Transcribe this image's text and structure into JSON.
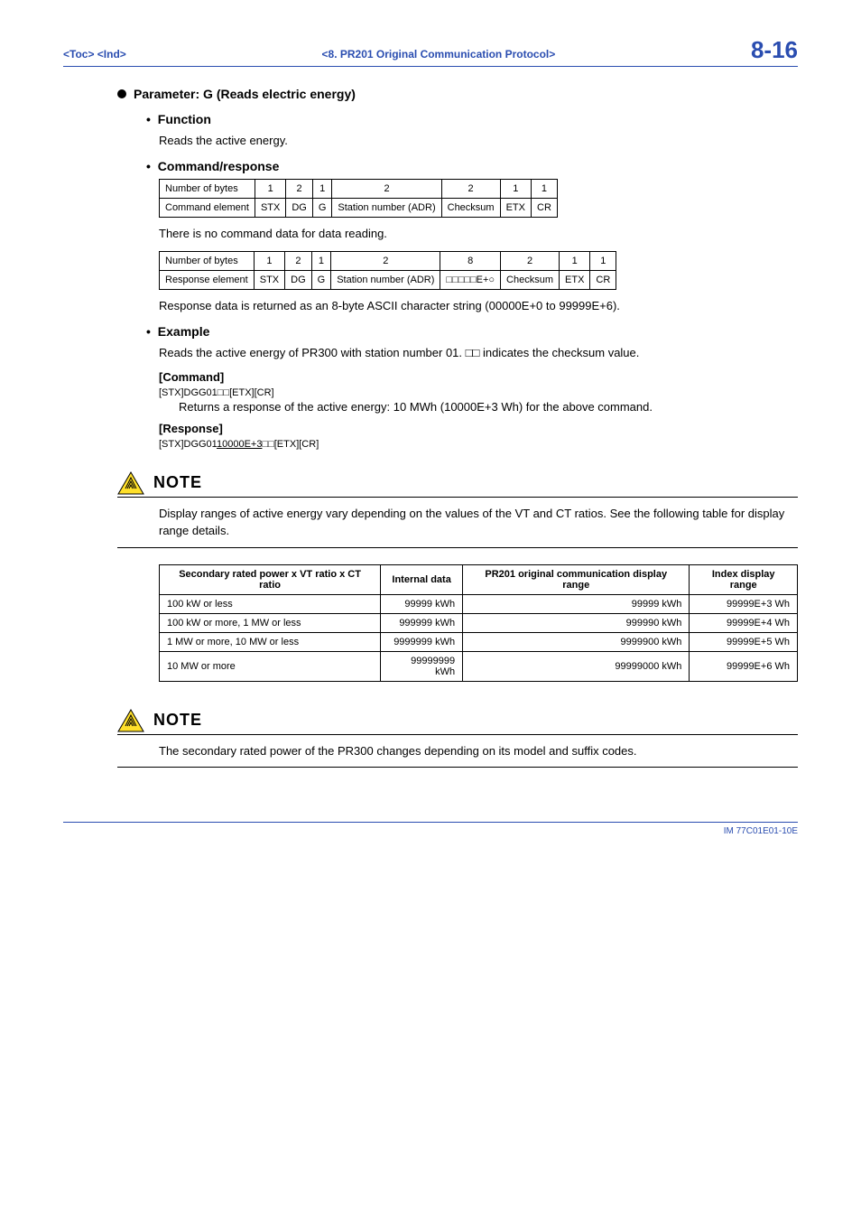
{
  "header": {
    "left": "<Toc> <Ind>",
    "center": "<8.  PR201 Original Communication Protocol>",
    "page": "8-16"
  },
  "param_heading": "Parameter: G (Reads electric energy)",
  "function": {
    "heading": "Function",
    "text": "Reads the active energy."
  },
  "cmdresp": {
    "heading": "Command/response",
    "table1": {
      "r1": [
        "Number of bytes",
        "1",
        "2",
        "1",
        "2",
        "2",
        "1",
        "1"
      ],
      "r2": [
        "Command element",
        "STX",
        "DG",
        "G",
        "Station number (ADR)",
        "Checksum",
        "ETX",
        "CR"
      ]
    },
    "note1": "There is no command data for data reading.",
    "table2": {
      "r1": [
        "Number of bytes",
        "1",
        "2",
        "1",
        "2",
        "8",
        "2",
        "1",
        "1"
      ],
      "r2": [
        "Response element",
        "STX",
        "DG",
        "G",
        "Station number (ADR)",
        "□□□□□E+○",
        "Checksum",
        "ETX",
        "CR"
      ]
    },
    "note2": "Response data is returned as an 8-byte ASCII character string (00000E+0 to 99999E+6)."
  },
  "example": {
    "heading": "Example",
    "intro": "Reads the active energy of PR300 with station number 01. □□ indicates the checksum value.",
    "cmd_label": "[Command]",
    "cmd_text": "[STX]DGG01□□[ETX][CR]",
    "cmd_result": "Returns a response of the active energy: 10 MWh (10000E+3 Wh) for the above command.",
    "resp_label": "[Response]",
    "resp_prefix": "[STX]DGG01",
    "resp_under": "10000E+3",
    "resp_suffix": "□□[ETX][CR]"
  },
  "note1": {
    "label": "NOTE",
    "text": "Display ranges of active energy vary depending on the values of the VT and CT ratios. See the following table for display range details.",
    "table": {
      "headers": [
        "Secondary rated power x VT ratio x CT ratio",
        "Internal data",
        "PR201 original communication display range",
        "Index display range"
      ],
      "rows": [
        [
          "100 kW or less",
          "99999 kWh",
          "99999 kWh",
          "99999E+3 Wh"
        ],
        [
          "100 kW or more, 1 MW or less",
          "999999 kWh",
          "999990 kWh",
          "99999E+4 Wh"
        ],
        [
          "1 MW or more, 10 MW or less",
          "9999999 kWh",
          "9999900 kWh",
          "99999E+5 Wh"
        ],
        [
          "10 MW or more",
          "99999999 kWh",
          "99999000 kWh",
          "99999E+6 Wh"
        ]
      ]
    }
  },
  "note2": {
    "label": "NOTE",
    "text": "The secondary rated power of the PR300 changes depending on its model and suffix codes."
  },
  "footer": "IM 77C01E01-10E"
}
